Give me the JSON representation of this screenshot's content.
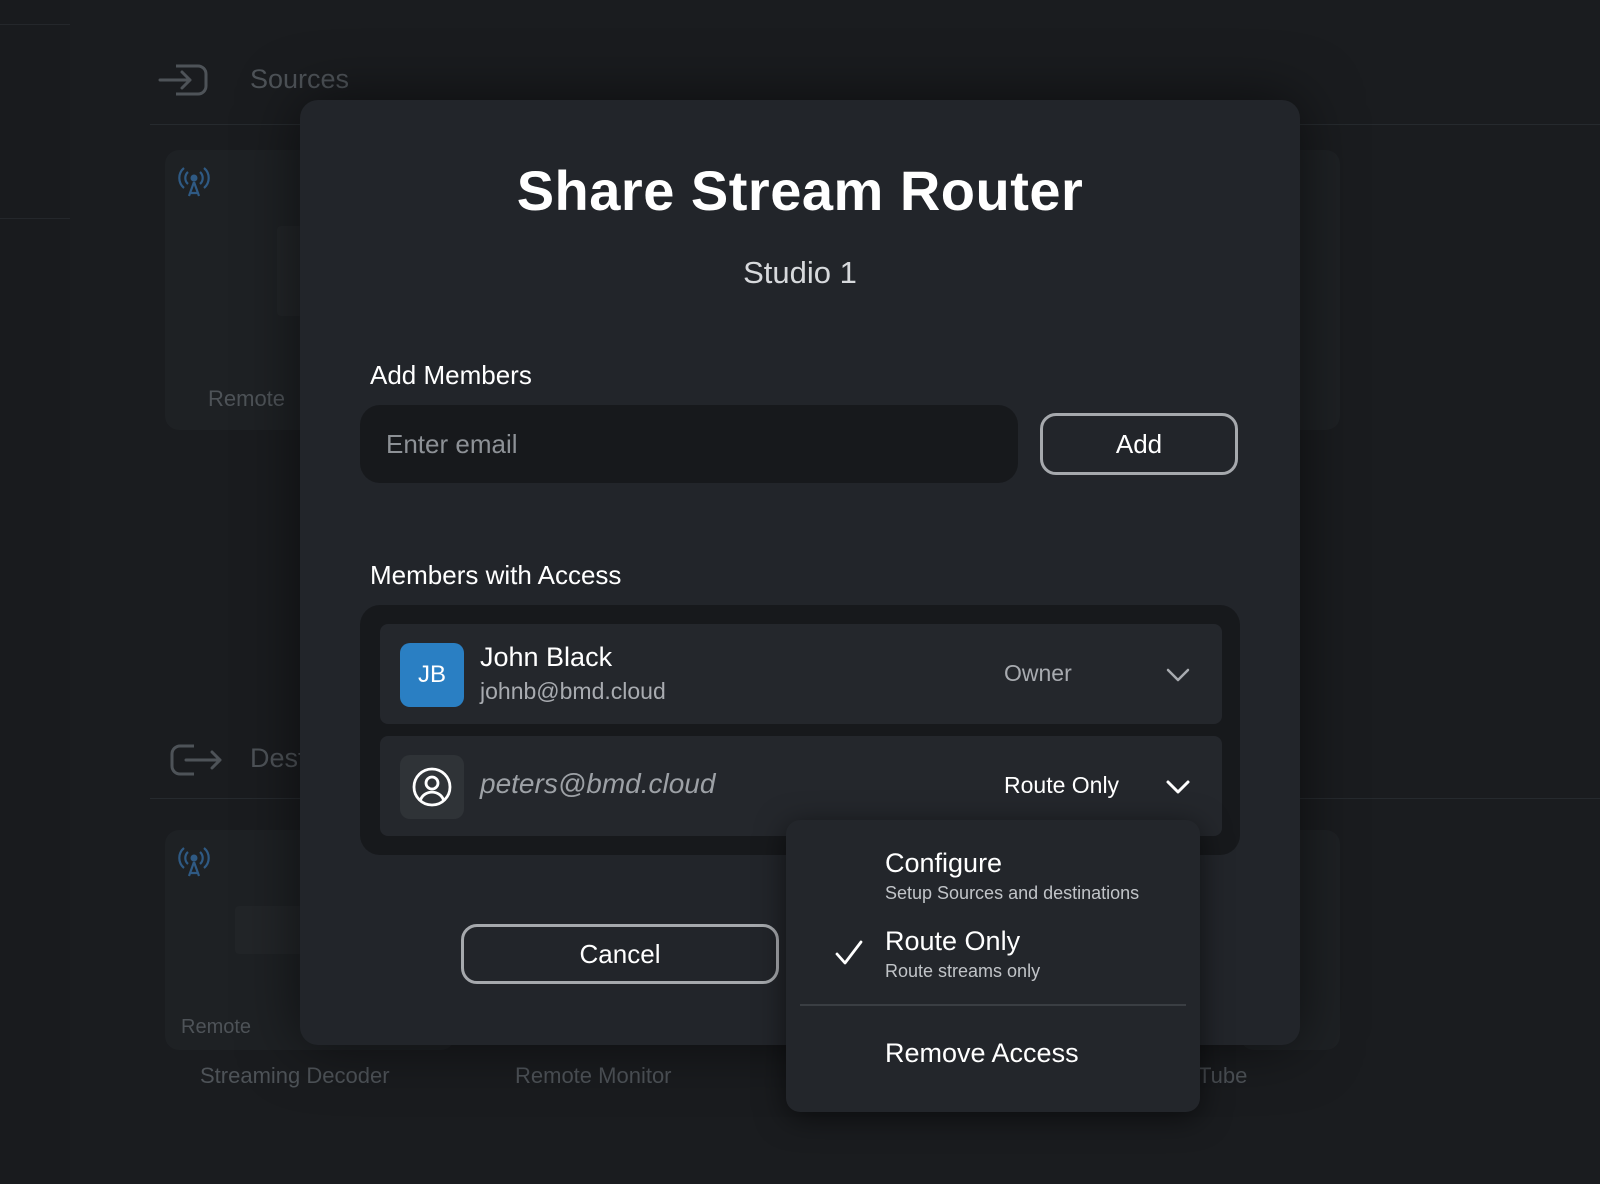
{
  "background": {
    "sections": {
      "sources_title": "Sources",
      "destinations_title": "Dest"
    },
    "cards": {
      "remote_label": "Remote",
      "remote_small_label": "Remote",
      "streaming_decoder": "Streaming Decoder",
      "remote_monitor": "Remote Monitor",
      "tube_label": "Tube"
    }
  },
  "modal": {
    "title": "Share Stream Router",
    "subtitle": "Studio 1",
    "add_members_label": "Add Members",
    "email_placeholder": "Enter email",
    "add_button": "Add",
    "members_label": "Members with Access",
    "members": [
      {
        "initials": "JB",
        "name": "John Black",
        "email": "johnb@bmd.cloud",
        "role": "Owner",
        "avatar_color": "#2a7fc3"
      },
      {
        "email": "peters@bmd.cloud",
        "role": "Route Only"
      }
    ],
    "cancel_button": "Cancel"
  },
  "dropdown": {
    "options": [
      {
        "title": "Configure",
        "subtitle": "Setup Sources and destinations",
        "selected": false
      },
      {
        "title": "Route Only",
        "subtitle": "Route streams only",
        "selected": true
      }
    ],
    "remove_label": "Remove Access"
  },
  "colors": {
    "background": "#1a1c1f",
    "modal": "#22252a",
    "accent": "#2a7fc3"
  }
}
